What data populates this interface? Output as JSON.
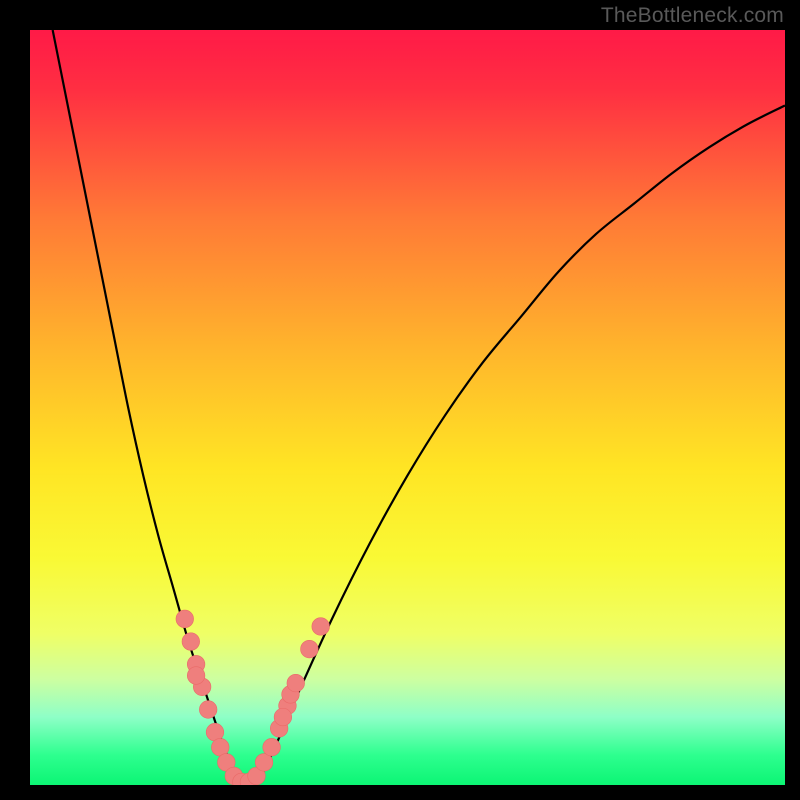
{
  "watermark": {
    "text": "TheBottleneck.com"
  },
  "colors": {
    "frame": "#000000",
    "curve": "#000000",
    "marker_fill": "#ef7f7d",
    "marker_stroke": "#ea6a68",
    "gradient_stops": [
      {
        "offset": 0,
        "color": "#ff1a47"
      },
      {
        "offset": 0.08,
        "color": "#ff2f42"
      },
      {
        "offset": 0.25,
        "color": "#ff7a36"
      },
      {
        "offset": 0.42,
        "color": "#ffb42c"
      },
      {
        "offset": 0.58,
        "color": "#ffe524"
      },
      {
        "offset": 0.7,
        "color": "#f9f935"
      },
      {
        "offset": 0.8,
        "color": "#efff66"
      },
      {
        "offset": 0.86,
        "color": "#cdffa1"
      },
      {
        "offset": 0.91,
        "color": "#8effc7"
      },
      {
        "offset": 0.96,
        "color": "#2eff8f"
      },
      {
        "offset": 1.0,
        "color": "#0cf574"
      }
    ]
  },
  "chart_data": {
    "type": "line",
    "title": "",
    "xlabel": "",
    "ylabel": "",
    "xlim": [
      0,
      100
    ],
    "ylim": [
      0,
      100
    ],
    "series": [
      {
        "name": "bottleneck-curve",
        "x": [
          3,
          5,
          7,
          9,
          11,
          13,
          15,
          17,
          19,
          21,
          23,
          25,
          26.5,
          28,
          30,
          32,
          35,
          40,
          45,
          50,
          55,
          60,
          65,
          70,
          75,
          80,
          85,
          90,
          95,
          100
        ],
        "y": [
          100,
          90,
          80,
          70,
          60,
          50,
          41,
          33,
          26,
          19,
          13,
          7,
          3,
          0.5,
          0.5,
          4,
          11,
          22,
          32,
          41,
          49,
          56,
          62,
          68,
          73,
          77,
          81,
          84.5,
          87.5,
          90
        ]
      }
    ],
    "markers": {
      "name": "anomaly-points",
      "points": [
        {
          "x": 20.5,
          "y": 22
        },
        {
          "x": 21.3,
          "y": 19
        },
        {
          "x": 22.0,
          "y": 16
        },
        {
          "x": 22.8,
          "y": 13
        },
        {
          "x": 22.0,
          "y": 14.5
        },
        {
          "x": 23.6,
          "y": 10
        },
        {
          "x": 24.5,
          "y": 7
        },
        {
          "x": 25.2,
          "y": 5
        },
        {
          "x": 26.0,
          "y": 3
        },
        {
          "x": 27.0,
          "y": 1.2
        },
        {
          "x": 28.0,
          "y": 0.4
        },
        {
          "x": 29.0,
          "y": 0.4
        },
        {
          "x": 30.0,
          "y": 1.2
        },
        {
          "x": 31.0,
          "y": 3
        },
        {
          "x": 32.0,
          "y": 5
        },
        {
          "x": 33.0,
          "y": 7.5
        },
        {
          "x": 34.1,
          "y": 10.5
        },
        {
          "x": 33.5,
          "y": 9
        },
        {
          "x": 34.5,
          "y": 12
        },
        {
          "x": 35.2,
          "y": 13.5
        },
        {
          "x": 37.0,
          "y": 18
        },
        {
          "x": 38.5,
          "y": 21
        }
      ]
    }
  }
}
